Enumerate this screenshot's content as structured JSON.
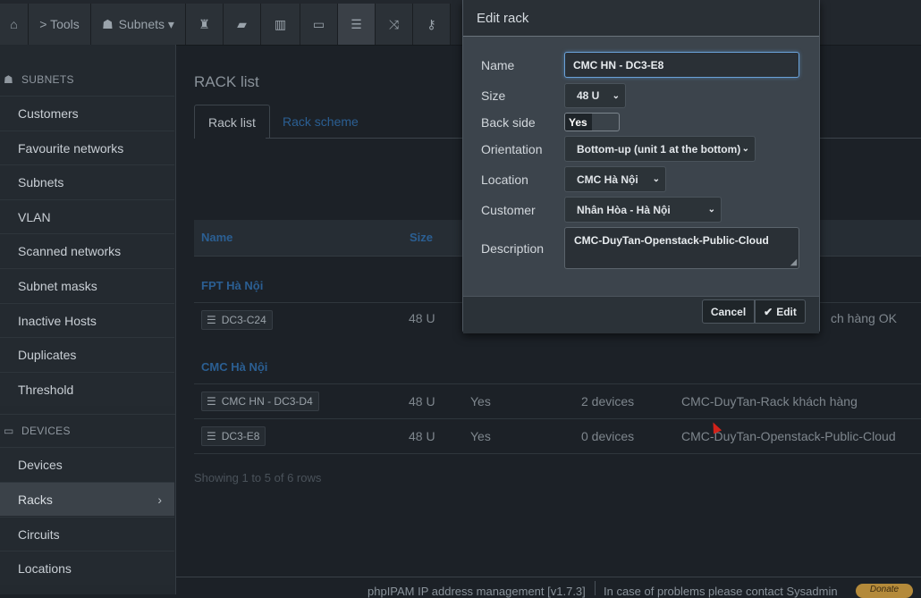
{
  "topbar": {
    "home_icon": "home-icon",
    "tools_label": "> Tools",
    "subnets_label": "Subnets ▾",
    "icons": [
      "network-icon",
      "folder-icon",
      "map-icon",
      "monitor-icon",
      "list-icon",
      "shuffle-icon",
      "key-icon"
    ]
  },
  "sidebar": {
    "subnets_header": "SUBNETS",
    "subnets_items": [
      "Customers",
      "Favourite networks",
      "Subnets",
      "VLAN",
      "Scanned networks",
      "Subnet masks",
      "Inactive Hosts",
      "Duplicates",
      "Threshold"
    ],
    "devices_header": "DEVICES",
    "devices_items": [
      "Devices",
      "Racks",
      "Circuits",
      "Locations"
    ],
    "active_item": "Racks",
    "active_chevron": "›"
  },
  "main": {
    "title": "RACK list",
    "tabs": [
      "Rack list",
      "Rack scheme"
    ],
    "columns": [
      "Name",
      "Size"
    ],
    "groups": [
      {
        "name": "FPT Hà Nội",
        "rows": [
          {
            "name": "DC3-C24",
            "size": "48 U",
            "back": "",
            "devices": "",
            "desc": "ch hàng OK"
          }
        ]
      },
      {
        "name": "CMC Hà Nội",
        "rows": [
          {
            "name": "CMC HN - DC3-D4",
            "size": "48 U",
            "back": "Yes",
            "devices": "2 devices",
            "desc": "CMC-DuyTan-Rack khách hàng"
          },
          {
            "name": "DC3-E8",
            "size": "48 U",
            "back": "Yes",
            "devices": "0 devices",
            "desc": "CMC-DuyTan-Openstack-Public-Cloud"
          }
        ]
      }
    ],
    "showing": "Showing 1 to 5 of 6 rows"
  },
  "footer": {
    "app": "phpIPAM IP address management [v1.7.3]",
    "contact": "In case of problems please contact Sysadmin",
    "donate": "Donate"
  },
  "modal": {
    "title": "Edit rack",
    "name_label": "Name",
    "name_value": "CMC HN - DC3-E8",
    "size_label": "Size",
    "size_value": "48 U",
    "back_label": "Back side",
    "back_value": "Yes",
    "orientation_label": "Orientation",
    "orientation_value": "Bottom-up (unit 1 at the bottom)",
    "location_label": "Location",
    "location_value": "CMC Hà Nội",
    "customer_label": "Customer",
    "customer_value": "Nhân Hòa - Hà Nội",
    "description_label": "Description",
    "description_value": "CMC-DuyTan-Openstack-Public-Cloud",
    "cancel_label": "Cancel",
    "edit_label": "Edit",
    "edit_icon": "checkmark-icon"
  }
}
